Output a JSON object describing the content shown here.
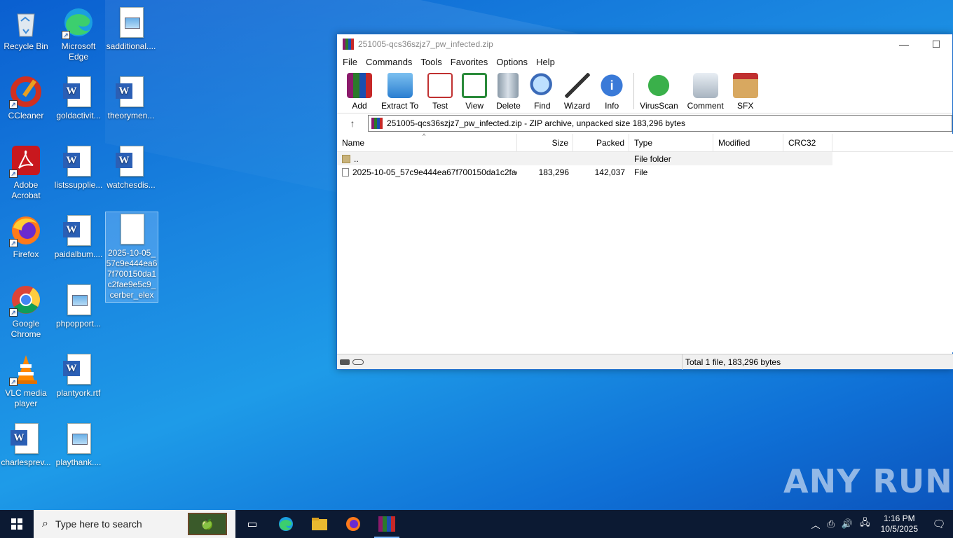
{
  "desktop": {
    "icons": [
      {
        "label": "Recycle Bin"
      },
      {
        "label": "Microsoft Edge"
      },
      {
        "label": "sadditional...."
      },
      {
        "label": "CCleaner"
      },
      {
        "label": "goldactivit..."
      },
      {
        "label": "theorymen..."
      },
      {
        "label": "Adobe Acrobat"
      },
      {
        "label": "listssupplie..."
      },
      {
        "label": "watchesdis..."
      },
      {
        "label": "Firefox"
      },
      {
        "label": "paidalbum...."
      },
      {
        "label": "2025-10-05_57c9e444ea67f700150da1c2fae9e5c9_cerber_elex"
      },
      {
        "label": "Google Chrome"
      },
      {
        "label": "phpopport..."
      },
      {
        "label": "VLC media player"
      },
      {
        "label": "plantyork.rtf"
      },
      {
        "label": "charlesprev..."
      },
      {
        "label": "playthank...."
      }
    ]
  },
  "window": {
    "title": "251005-qcs36szjz7_pw_infected.zip",
    "minimize": "—",
    "maximize": "☐",
    "menu": [
      "File",
      "Commands",
      "Tools",
      "Favorites",
      "Options",
      "Help"
    ],
    "toolbar": [
      "Add",
      "Extract To",
      "Test",
      "View",
      "Delete",
      "Find",
      "Wizard",
      "Info",
      "VirusScan",
      "Comment",
      "SFX"
    ],
    "address": "251005-qcs36szjz7_pw_infected.zip - ZIP archive, unpacked size 183,296 bytes",
    "columns": [
      "Name",
      "Size",
      "Packed",
      "Type",
      "Modified",
      "CRC32"
    ],
    "rows": [
      {
        "name": "..",
        "size": "",
        "packed": "",
        "type": "File folder",
        "modified": "",
        "crc": ""
      },
      {
        "name": "2025-10-05_57c9e444ea67f700150da1c2fae...",
        "size": "183,296",
        "packed": "142,037",
        "type": "File",
        "modified": "",
        "crc": ""
      }
    ],
    "status": "Total 1 file, 183,296 bytes"
  },
  "taskbar": {
    "search_placeholder": "Type here to search",
    "time": "1:16 PM",
    "date": "10/5/2025"
  },
  "watermark": "ANY RUN"
}
